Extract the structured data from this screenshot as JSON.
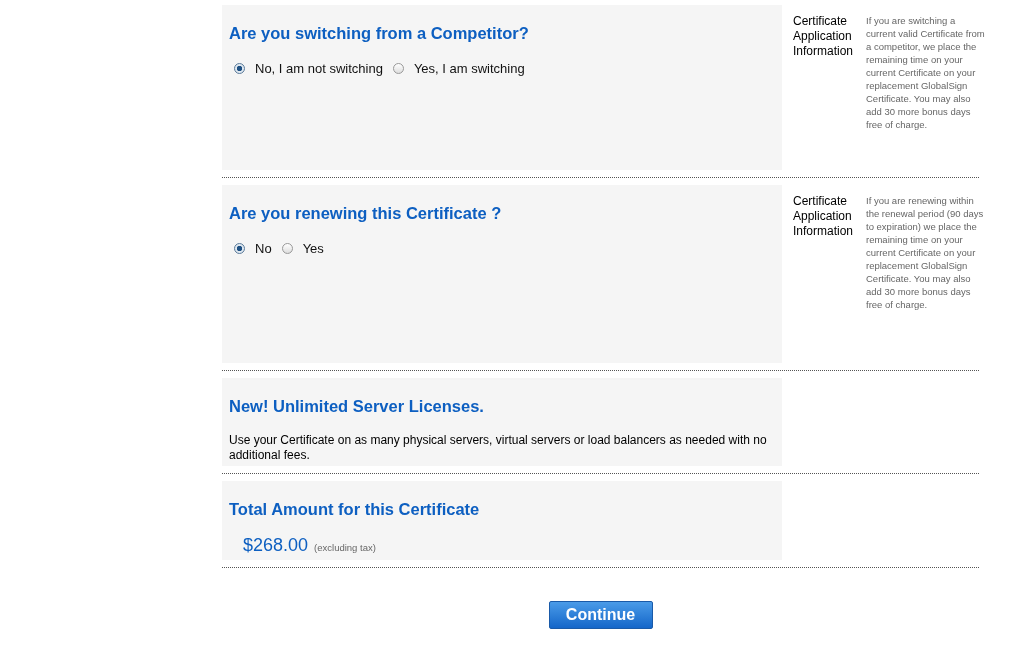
{
  "sections": [
    {
      "kind": "question",
      "title": "Are you switching from a Competitor?",
      "options": [
        {
          "label": "No, I am not switching",
          "selected": true
        },
        {
          "label": "Yes, I am switching",
          "selected": false
        }
      ],
      "side_label": "Certificate Application Information",
      "side_text": "If you are switching a current valid Certificate from a competitor, we place the remaining time on your current Certificate on your replacement GlobalSign Certificate. You may also add 30 more bonus days free of charge."
    },
    {
      "kind": "question",
      "title": "Are you renewing this Certificate ?",
      "options": [
        {
          "label": "No",
          "selected": true
        },
        {
          "label": "Yes",
          "selected": false
        }
      ],
      "side_label": "Certificate Application Information",
      "side_text": "If you are renewing within the renewal period (90 days to expiration) we place the remaining time on your current Certificate on your replacement GlobalSign Certificate. You may also add 30 more bonus days free of charge."
    },
    {
      "kind": "info",
      "title": "New! Unlimited Server Licenses.",
      "text": "Use your Certificate on as many physical servers, virtual servers or load balancers as needed with no additional fees."
    },
    {
      "kind": "total",
      "title": "Total Amount for this Certificate",
      "price": "$268.00",
      "note": "(excluding tax)"
    }
  ],
  "button": "Continue"
}
